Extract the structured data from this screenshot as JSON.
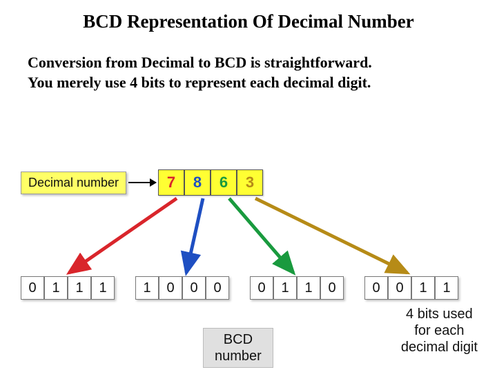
{
  "title": "BCD Representation Of Decimal Number",
  "body": {
    "line1": "Conversion from Decimal to BCD is straightforward.",
    "line2": "You merely use 4 bits to represent each decimal digit."
  },
  "decimal_label": "Decimal number",
  "decimal_digits": [
    {
      "value": "7",
      "color": "red"
    },
    {
      "value": "8",
      "color": "blue"
    },
    {
      "value": "6",
      "color": "green"
    },
    {
      "value": "3",
      "color": "gold"
    }
  ],
  "bcd_groups": [
    {
      "bits": [
        "0",
        "1",
        "1",
        "1"
      ],
      "color": "red"
    },
    {
      "bits": [
        "1",
        "0",
        "0",
        "0"
      ],
      "color": "blue"
    },
    {
      "bits": [
        "0",
        "1",
        "1",
        "0"
      ],
      "color": "green"
    },
    {
      "bits": [
        "0",
        "0",
        "1",
        "1"
      ],
      "color": "gold"
    }
  ],
  "bcd_label": {
    "l1": "BCD",
    "l2": "number"
  },
  "caption": {
    "l1": "4 bits used",
    "l2": "for each",
    "l3": "decimal digit"
  },
  "colors": {
    "red": "#d9252b",
    "blue": "#1e4fc2",
    "green": "#199a3e",
    "gold": "#b68b17"
  }
}
